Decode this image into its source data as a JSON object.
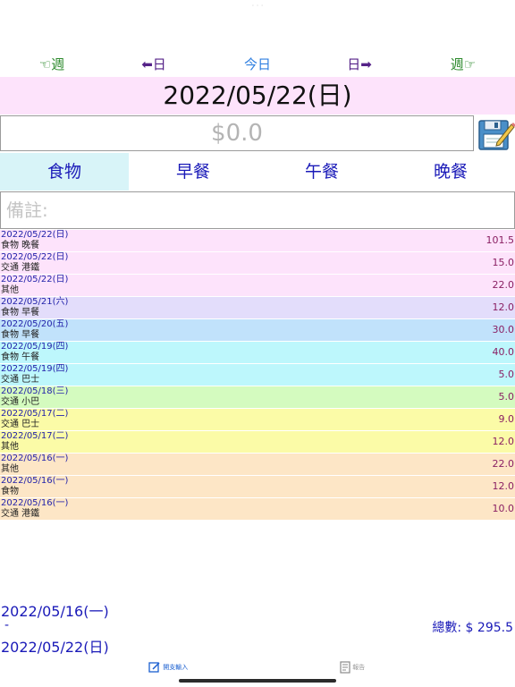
{
  "top_dots": "· · ·",
  "nav": {
    "prev_week": "☜週",
    "prev_day": "⬅日",
    "today": "今日",
    "next_day": "日➡",
    "next_week": "週☞"
  },
  "date_header": "2022/05/22(日)",
  "amount": {
    "placeholder": "$0.0"
  },
  "category_tabs": [
    "食物",
    "早餐",
    "午餐",
    "晚餐"
  ],
  "active_tab": "食物",
  "note": {
    "placeholder": "備註:"
  },
  "entries": [
    {
      "date": "2022/05/22(日)",
      "category": "食物 晚餐",
      "amount": "101.5",
      "color": "#fde3fb"
    },
    {
      "date": "2022/05/22(日)",
      "category": "交通 港鐵",
      "amount": "15.0",
      "color": "#fde3fb"
    },
    {
      "date": "2022/05/22(日)",
      "category": "其他",
      "amount": "22.0",
      "color": "#fde3fb"
    },
    {
      "date": "2022/05/21(六)",
      "category": "食物 早餐",
      "amount": "12.0",
      "color": "#e3ddfb"
    },
    {
      "date": "2022/05/20(五)",
      "category": "食物 早餐",
      "amount": "30.0",
      "color": "#c1e2fb"
    },
    {
      "date": "2022/05/19(四)",
      "category": "食物 午餐",
      "amount": "40.0",
      "color": "#bdf7fc"
    },
    {
      "date": "2022/05/19(四)",
      "category": "交通 巴士",
      "amount": "5.0",
      "color": "#bdf7fc"
    },
    {
      "date": "2022/05/18(三)",
      "category": "交通 小巴",
      "amount": "5.0",
      "color": "#d4fbbf"
    },
    {
      "date": "2022/05/17(二)",
      "category": "交通 巴士",
      "amount": "9.0",
      "color": "#fbfba7"
    },
    {
      "date": "2022/05/17(二)",
      "category": "其他",
      "amount": "12.0",
      "color": "#fbfba7"
    },
    {
      "date": "2022/05/16(一)",
      "category": "其他",
      "amount": "22.0",
      "color": "#fde6c6"
    },
    {
      "date": "2022/05/16(一)",
      "category": "食物",
      "amount": "12.0",
      "color": "#fde6c6"
    },
    {
      "date": "2022/05/16(一)",
      "category": "交通 港鐵",
      "amount": "10.0",
      "color": "#fde6c6"
    }
  ],
  "summary": {
    "range_from": "2022/05/16(一)",
    "range_dash": "-",
    "range_to": "2022/05/22(日)",
    "total": "總數: $ 295.5"
  },
  "tabbar": {
    "input_label": "開支輸入",
    "report_label": "報告"
  },
  "colors": {
    "accent_blue": "#1a1ab8",
    "nav_green": "#2e8b2e",
    "today_blue": "#2f7fe0",
    "nav_purple": "#552288",
    "header_pink": "#fde3fb",
    "active_tab_bg": "#d8f4f8"
  },
  "icons": {
    "save": "floppy-disk-pencil-icon",
    "input": "edit-square-icon",
    "report": "document-icon"
  }
}
